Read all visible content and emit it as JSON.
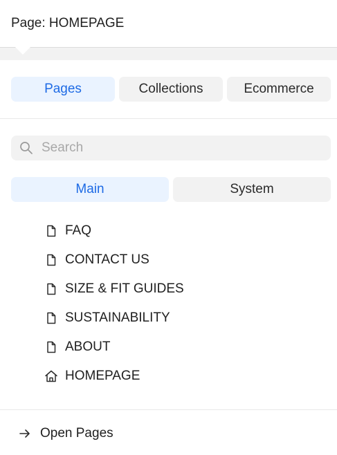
{
  "header": {
    "title": "Page: HOMEPAGE"
  },
  "type_tabs": [
    {
      "label": "Pages",
      "active": true
    },
    {
      "label": "Collections",
      "active": false
    },
    {
      "label": "Ecommerce",
      "active": false
    }
  ],
  "search": {
    "placeholder": "Search",
    "value": "",
    "icon": "search-icon"
  },
  "scope_tabs": [
    {
      "label": "Main",
      "active": true
    },
    {
      "label": "System",
      "active": false
    }
  ],
  "pages": [
    {
      "label": "FAQ",
      "icon": "page-icon"
    },
    {
      "label": "CONTACT US",
      "icon": "page-icon"
    },
    {
      "label": "SIZE & FIT GUIDES",
      "icon": "page-icon"
    },
    {
      "label": "SUSTAINABILITY",
      "icon": "page-icon"
    },
    {
      "label": "ABOUT",
      "icon": "page-icon"
    },
    {
      "label": "HOMEPAGE",
      "icon": "home-icon"
    }
  ],
  "footer": {
    "label": "Open Pages",
    "icon": "arrow-right-icon"
  },
  "colors": {
    "accent": "#1d6ae5",
    "active_bg": "#eaf3ff",
    "inactive_bg": "#f2f2f2",
    "text": "#1f1f1f",
    "placeholder": "#a8a8a8"
  }
}
